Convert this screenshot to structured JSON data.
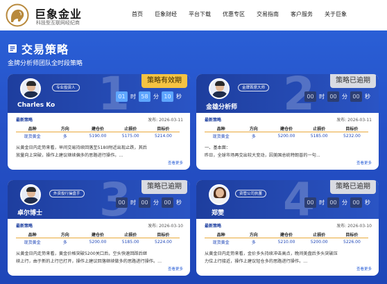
{
  "header": {
    "brand_name": "巨象金业",
    "brand_tagline": "科技型互联网经纪商",
    "nav": [
      "首页",
      "巨象财经",
      "平台下载",
      "优惠专区",
      "交易指南",
      "客户服务",
      "关于巨象"
    ]
  },
  "hero": {
    "title": "交易策略",
    "subtitle": "金牌分析师团队全时段策略"
  },
  "labels": {
    "latest": "最新策略",
    "more": "查看更多",
    "unit_hour": "时",
    "unit_min": "分",
    "unit_sec": "秒",
    "columns": [
      "品种",
      "方向",
      "建仓价",
      "止损价",
      "目标价"
    ]
  },
  "cards": [
    {
      "number": "1",
      "name": "Charles Ko",
      "tag": "专业投资人",
      "status": "策略有效期",
      "countdown": [
        "01",
        "58",
        "10"
      ],
      "pubdate": "发布: 2026-03-11",
      "row": [
        "现货黄金",
        "多",
        "5190.00",
        "5175.00",
        "5214.00"
      ],
      "text": [
        "从黄金日内走势来看，早间交易持续回落至5180附近出现止跌，其后",
        "放量向上突破，操作上建议继续偏多的思路进行操作。..."
      ]
    },
    {
      "number": "2",
      "name": "金雄分析师",
      "tag": "金牌首席大师",
      "status": "策略已逾期",
      "countdown": [
        "00",
        "00",
        "00"
      ],
      "pubdate": "发布: 2026-03-11",
      "row": [
        "现货黄金",
        "多",
        "5200.00",
        "5185.00",
        "5232.00"
      ],
      "text": [
        "一、基本面：",
        "昨日，全球市场再交出较大变动，因美国总统特朗普的一句..."
      ]
    },
    {
      "number": "3",
      "name": "卓尔博士",
      "tag": "外资投行操盘手",
      "status": "策略已逾期",
      "countdown": [
        "00",
        "00",
        "00"
      ],
      "pubdate": "发布: 2026-03-10",
      "row": [
        "现货黄金",
        "多",
        "5200.00",
        "5185.00",
        "5224.00"
      ],
      "text": [
        "从黄金日内走势来看，黄金价格突破5200关口后，空头快速回踩后继",
        "续上行，由于新的上行已打开，操作上建议回落继续做多的思路进行操作。..."
      ]
    },
    {
      "number": "4",
      "name": "郑雯",
      "tag": "资管公司执董",
      "status": "策略已逾期",
      "countdown": [
        "00",
        "00",
        "00"
      ],
      "pubdate": "发布: 2026-03-10",
      "row": [
        "现货黄金",
        "多",
        "5210.00",
        "5200.00",
        "5226.00"
      ],
      "text": [
        "从黄金日内走势来看，金价多头持续冲击高点，晚间美盘后多头突破压",
        "力位上行接近，操作上建议轻仓多的思路进行操作。..."
      ]
    }
  ],
  "colors": {
    "brand_blue": "#2550c6",
    "gold_badge": "#f5c342",
    "expired_badge": "#d9dbe2",
    "accent_line": "#e9a93a"
  }
}
